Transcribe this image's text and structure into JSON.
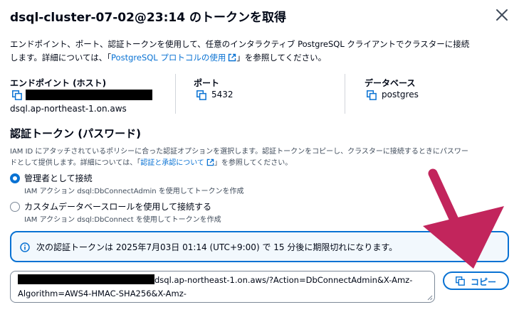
{
  "dialog": {
    "title": "dsql-cluster-07-02@23:14 のトークンを取得",
    "close_icon": "close-icon"
  },
  "description": {
    "line1": "エンドポイント、ポート、認証トークンを使用して、任意のインタラクティブ PostgreSQL クライアントでクラスターに接続",
    "line2_prefix": "します。詳細については、「",
    "link": "PostgreSQL プロトコルの使用",
    "line2_suffix": "」を参照してください。"
  },
  "connection": {
    "endpoint_label": "エンドポイント (ホスト)",
    "endpoint_value": "dsql.ap-northeast-1.on.aws",
    "port_label": "ポート",
    "port_value": "5432",
    "database_label": "データベース",
    "database_value": "postgres"
  },
  "auth": {
    "title": "認証トークン (パスワード)",
    "desc_line1": "IAM ID にアタッチされているポリシーに合った認証オプションを選択します。認証トークンをコピーし、クラスターに接続するときにパスワー",
    "desc_line2_prefix": "ドとして提供します。詳細については、「",
    "desc_link": "認証と承認について",
    "desc_line2_suffix": "」を参照してください。",
    "options": [
      {
        "label": "管理者として接続",
        "desc": "IAM アクション dsql:DbConnectAdmin を使用してトークンを作成",
        "selected": true
      },
      {
        "label": "カスタムデータベースロールを使用して接続する",
        "desc": "IAM アクション dsql:DbConnect を使用してトークンを作成",
        "selected": false
      }
    ]
  },
  "alert": {
    "icon": "info-icon",
    "text": "次の認証トークンは 2025年7月03日 01:14 (UTC+9:00) で 15 分後に期限切れになります。"
  },
  "token": {
    "line1": "dsql.ap-northeast-1.on.aws/?Action=DbConnectAdmin&X-Amz-",
    "line2": "Algorithm=AWS4-HMAC-SHA256&X-Amz-"
  },
  "copy_button": {
    "label": "コピー",
    "icon": "copy-icon"
  },
  "colors": {
    "accent": "#0972d3",
    "alert_bg": "#f2f8fd",
    "arrow": "#c2255c",
    "text": "#000716"
  }
}
